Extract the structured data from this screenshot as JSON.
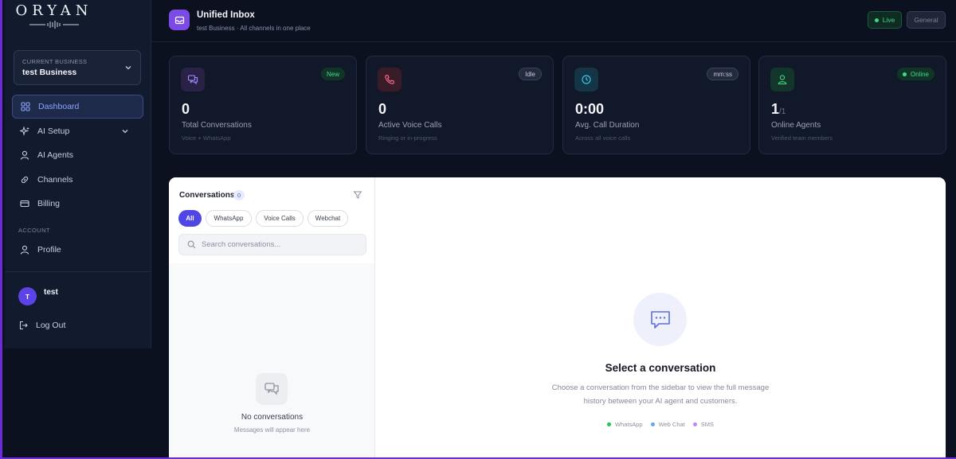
{
  "brand": {
    "logo_text": "ORYAN"
  },
  "sidebar": {
    "business": {
      "label": "CURRENT BUSINESS",
      "name": "test Business"
    },
    "nav": [
      {
        "label": "Dashboard",
        "icon": "grid-icon",
        "active": true
      },
      {
        "label": "AI Setup",
        "icon": "sparkles-icon"
      },
      {
        "label": "AI Agents",
        "icon": "user-icon"
      },
      {
        "label": "Channels",
        "icon": "link-icon"
      },
      {
        "label": "Billing",
        "icon": "card-icon"
      }
    ],
    "account_section": "ACCOUNT",
    "profile": "Profile",
    "user": {
      "initial": "T",
      "name": "test"
    },
    "logout": "Log Out"
  },
  "header": {
    "title": "Unified Inbox",
    "subtitle": "test Business · All channels in one place",
    "live_label": "Live",
    "general_label": "General"
  },
  "stats": [
    {
      "value": "0",
      "label": "Total Conversations",
      "sub": "Voice + WhatsApp",
      "badge": "New",
      "icon": "chat-icon"
    },
    {
      "value": "0",
      "label": "Active Voice Calls",
      "sub": "Ringing or in-progress",
      "badge": "Idle",
      "icon": "phone-icon"
    },
    {
      "value": "0:00",
      "label": "Avg. Call Duration",
      "sub": "Across all voice calls",
      "badge": "mm:ss",
      "icon": "clock-icon"
    },
    {
      "value": "1",
      "value_suffix": "/1",
      "label": "Online Agents",
      "sub": "Verified team members",
      "badge": "Online",
      "icon": "agent-icon"
    }
  ],
  "conversations": {
    "title": "Conversations",
    "count": "0",
    "filters": [
      "All",
      "WhatsApp",
      "Voice Calls",
      "Webchat"
    ],
    "search_placeholder": "Search conversations...",
    "empty_title": "No conversations",
    "empty_sub": "Messages will appear here"
  },
  "detail": {
    "title": "Select a conversation",
    "description": "Choose a conversation from the sidebar to view the full message history between your AI agent and customers.",
    "channels": [
      {
        "label": "WhatsApp",
        "color": "#22c55e"
      },
      {
        "label": "Web Chat",
        "color": "#60a5fa"
      },
      {
        "label": "SMS",
        "color": "#c084fc"
      }
    ]
  },
  "colors": {
    "accent": "#4f46e5",
    "live": "#3fd68a",
    "sidebar_bg": "#121a2e",
    "page_bg": "#0c1120"
  }
}
